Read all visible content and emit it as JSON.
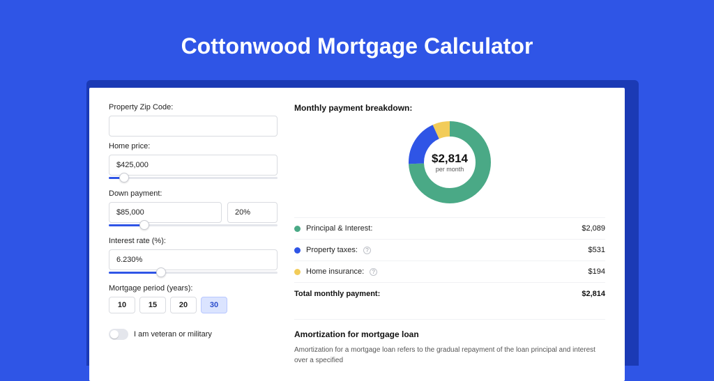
{
  "title": "Cottonwood Mortgage Calculator",
  "form": {
    "zip_label": "Property Zip Code:",
    "zip_value": "",
    "home_price_label": "Home price:",
    "home_price_value": "$425,000",
    "down_payment_label": "Down payment:",
    "down_payment_value": "$85,000",
    "down_payment_pct": "20%",
    "interest_label": "Interest rate (%):",
    "interest_value": "6.230%",
    "period_label": "Mortgage period (years):",
    "period_options": [
      "10",
      "15",
      "20",
      "30"
    ],
    "period_selected": "30",
    "veteran_label": "I am veteran or military"
  },
  "breakdown": {
    "heading": "Monthly payment breakdown:",
    "center_value": "$2,814",
    "center_sub": "per month",
    "items": [
      {
        "label": "Principal & Interest:",
        "value": "$2,089",
        "color": "#4aa986",
        "info": false
      },
      {
        "label": "Property taxes:",
        "value": "$531",
        "color": "#2f55e6",
        "info": true
      },
      {
        "label": "Home insurance:",
        "value": "$194",
        "color": "#f2cc59",
        "info": true
      }
    ],
    "total_label": "Total monthly payment:",
    "total_value": "$2,814"
  },
  "chart_data": {
    "type": "pie",
    "title": "Monthly payment breakdown",
    "series": [
      {
        "name": "Principal & Interest",
        "value": 2089,
        "color": "#4aa986"
      },
      {
        "name": "Property taxes",
        "value": 531,
        "color": "#2f55e6"
      },
      {
        "name": "Home insurance",
        "value": 194,
        "color": "#f2cc59"
      }
    ],
    "total": 2814
  },
  "amortization": {
    "heading": "Amortization for mortgage loan",
    "text": "Amortization for a mortgage loan refers to the gradual repayment of the loan principal and interest over a specified"
  }
}
